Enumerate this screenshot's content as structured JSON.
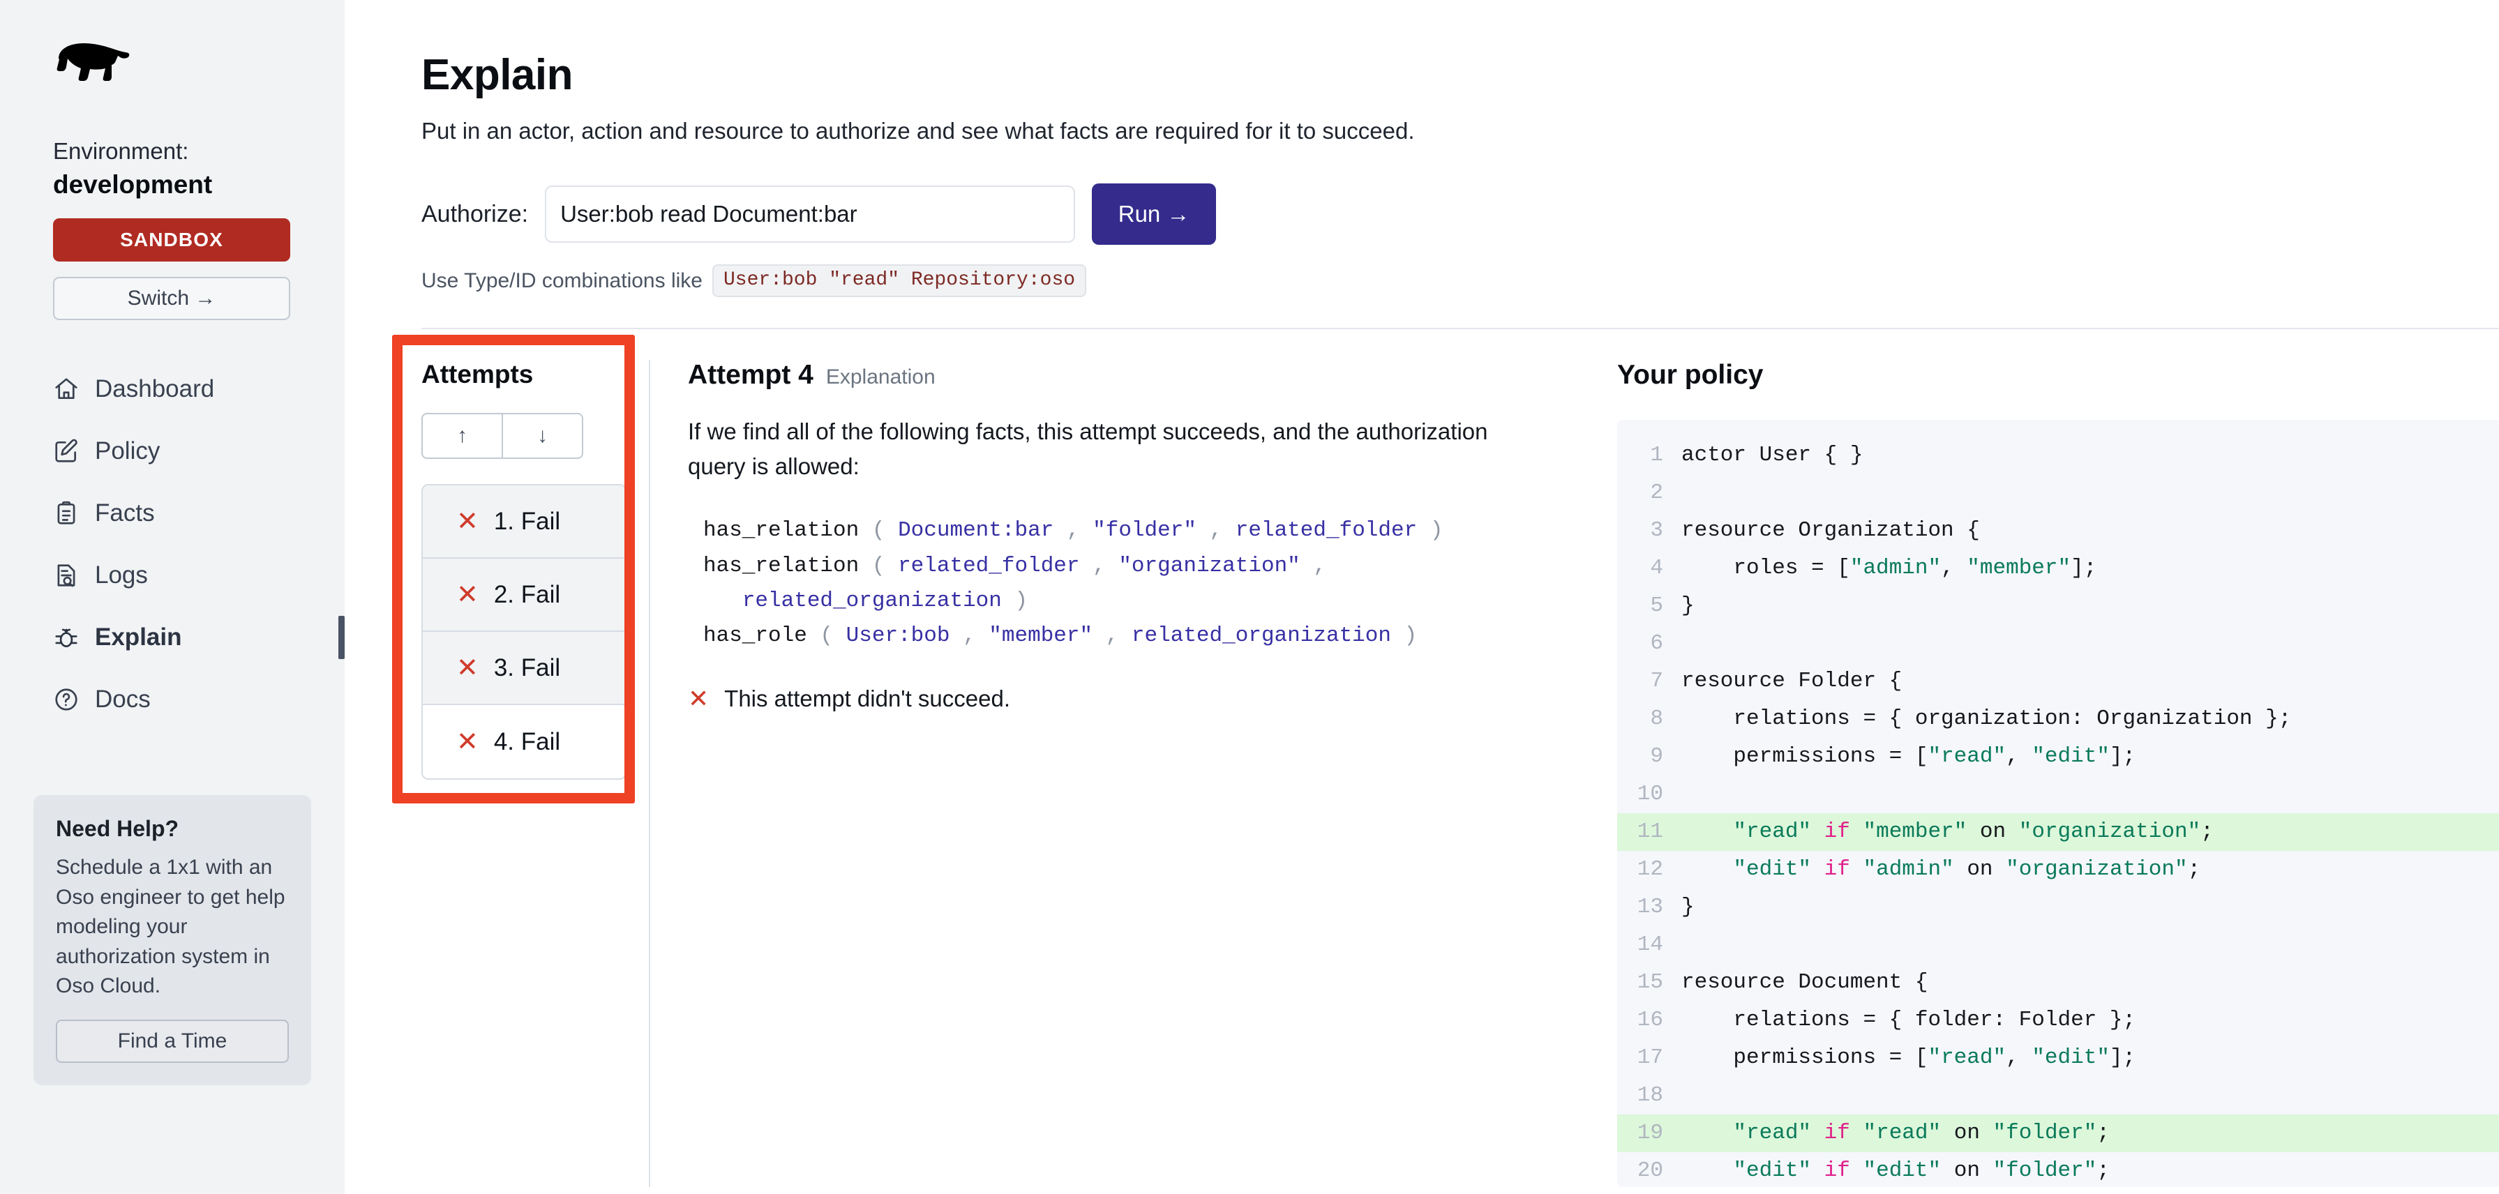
{
  "sidebar": {
    "logo_icon": "bear-logo-icon",
    "environment_label": "Environment:",
    "environment_value": "development",
    "sandbox_badge": "SANDBOX",
    "switch_label": "Switch →",
    "nav": [
      {
        "label": "Dashboard",
        "icon": "home-icon",
        "active": false
      },
      {
        "label": "Policy",
        "icon": "edit-square-icon",
        "active": false
      },
      {
        "label": "Facts",
        "icon": "clipboard-list-icon",
        "active": false
      },
      {
        "label": "Logs",
        "icon": "document-search-icon",
        "active": false
      },
      {
        "label": "Explain",
        "icon": "bug-icon",
        "active": true
      },
      {
        "label": "Docs",
        "icon": "question-circle-icon",
        "active": false
      }
    ],
    "help": {
      "title": "Need Help?",
      "body": "Schedule a 1x1 with an Oso engineer to get help modeling your authorization system in Oso Cloud.",
      "button": "Find a Time"
    }
  },
  "page": {
    "title": "Explain",
    "subtitle": "Put in an actor, action and resource to authorize and see what facts are required for it to succeed."
  },
  "authorize": {
    "label": "Authorize:",
    "value": "User:bob read Document:bar",
    "placeholder": "User:bob read Document:bar",
    "run_label": "Run →",
    "hint_prefix": "Use Type/ID combinations like",
    "hint_code": "User:bob \"read\" Repository:oso"
  },
  "attempts": {
    "title": "Attempts",
    "sort_up": "↑",
    "sort_down": "↓",
    "items": [
      {
        "label": "1. Fail",
        "status_icon": "x-icon",
        "selected": false
      },
      {
        "label": "2. Fail",
        "status_icon": "x-icon",
        "selected": false
      },
      {
        "label": "3. Fail",
        "status_icon": "x-icon",
        "selected": false
      },
      {
        "label": "4. Fail",
        "status_icon": "x-icon",
        "selected": true
      }
    ]
  },
  "explanation": {
    "heading": "Attempt 4",
    "subheading": "Explanation",
    "paragraph": "If we find all of the following facts, this attempt succeeds, and the authorization query is allowed:",
    "facts": [
      [
        {
          "t": "has_relation",
          "k": "pred"
        },
        {
          "t": " ( ",
          "k": "punc"
        },
        {
          "t": "Document:bar",
          "k": "arg"
        },
        {
          "t": " , ",
          "k": "punc"
        },
        {
          "t": "\"folder\"",
          "k": "arg"
        },
        {
          "t": " , ",
          "k": "punc"
        },
        {
          "t": "related_folder",
          "k": "arg"
        },
        {
          "t": " )",
          "k": "punc"
        }
      ],
      [
        {
          "t": "has_relation",
          "k": "pred"
        },
        {
          "t": " ( ",
          "k": "punc"
        },
        {
          "t": "related_folder",
          "k": "arg"
        },
        {
          "t": " , ",
          "k": "punc"
        },
        {
          "t": "\"organization\"",
          "k": "arg"
        },
        {
          "t": " ,\n   ",
          "k": "punc"
        },
        {
          "t": "related_organization",
          "k": "arg"
        },
        {
          "t": " )",
          "k": "punc"
        }
      ],
      [
        {
          "t": "has_role",
          "k": "pred"
        },
        {
          "t": " ( ",
          "k": "punc"
        },
        {
          "t": "User:bob",
          "k": "arg"
        },
        {
          "t": " , ",
          "k": "punc"
        },
        {
          "t": "\"member\"",
          "k": "arg"
        },
        {
          "t": " , ",
          "k": "punc"
        },
        {
          "t": "related_organization",
          "k": "arg"
        },
        {
          "t": " )",
          "k": "punc"
        }
      ]
    ],
    "result_icon": "x-icon",
    "result_text": "This attempt didn't succeed."
  },
  "policy": {
    "title": "Your policy",
    "lines": [
      {
        "n": "1",
        "hl": false,
        "parts": [
          {
            "t": "actor User { }",
            "k": "txt"
          }
        ]
      },
      {
        "n": "2",
        "hl": false,
        "parts": []
      },
      {
        "n": "3",
        "hl": false,
        "parts": [
          {
            "t": "resource Organization {",
            "k": "txt"
          }
        ]
      },
      {
        "n": "4",
        "hl": false,
        "parts": [
          {
            "t": "    roles = [",
            "k": "txt"
          },
          {
            "t": "\"admin\"",
            "k": "str"
          },
          {
            "t": ", ",
            "k": "txt"
          },
          {
            "t": "\"member\"",
            "k": "str"
          },
          {
            "t": "];",
            "k": "txt"
          }
        ]
      },
      {
        "n": "5",
        "hl": false,
        "parts": [
          {
            "t": "}",
            "k": "txt"
          }
        ]
      },
      {
        "n": "6",
        "hl": false,
        "parts": []
      },
      {
        "n": "7",
        "hl": false,
        "parts": [
          {
            "t": "resource Folder {",
            "k": "txt"
          }
        ]
      },
      {
        "n": "8",
        "hl": false,
        "parts": [
          {
            "t": "    relations = { organization: Organization };",
            "k": "txt"
          }
        ]
      },
      {
        "n": "9",
        "hl": false,
        "parts": [
          {
            "t": "    permissions = [",
            "k": "txt"
          },
          {
            "t": "\"read\"",
            "k": "str"
          },
          {
            "t": ", ",
            "k": "txt"
          },
          {
            "t": "\"edit\"",
            "k": "str"
          },
          {
            "t": "];",
            "k": "txt"
          }
        ]
      },
      {
        "n": "10",
        "hl": false,
        "parts": []
      },
      {
        "n": "11",
        "hl": true,
        "parts": [
          {
            "t": "    ",
            "k": "txt"
          },
          {
            "t": "\"read\"",
            "k": "str"
          },
          {
            "t": " ",
            "k": "txt"
          },
          {
            "t": "if",
            "k": "kw"
          },
          {
            "t": " ",
            "k": "txt"
          },
          {
            "t": "\"member\"",
            "k": "str"
          },
          {
            "t": " on ",
            "k": "txt"
          },
          {
            "t": "\"organization\"",
            "k": "str"
          },
          {
            "t": ";",
            "k": "txt"
          }
        ]
      },
      {
        "n": "12",
        "hl": false,
        "parts": [
          {
            "t": "    ",
            "k": "txt"
          },
          {
            "t": "\"edit\"",
            "k": "str"
          },
          {
            "t": " ",
            "k": "txt"
          },
          {
            "t": "if",
            "k": "kw"
          },
          {
            "t": " ",
            "k": "txt"
          },
          {
            "t": "\"admin\"",
            "k": "str"
          },
          {
            "t": " on ",
            "k": "txt"
          },
          {
            "t": "\"organization\"",
            "k": "str"
          },
          {
            "t": ";",
            "k": "txt"
          }
        ]
      },
      {
        "n": "13",
        "hl": false,
        "parts": [
          {
            "t": "}",
            "k": "txt"
          }
        ]
      },
      {
        "n": "14",
        "hl": false,
        "parts": []
      },
      {
        "n": "15",
        "hl": false,
        "parts": [
          {
            "t": "resource Document {",
            "k": "txt"
          }
        ]
      },
      {
        "n": "16",
        "hl": false,
        "parts": [
          {
            "t": "    relations = { folder: Folder };",
            "k": "txt"
          }
        ]
      },
      {
        "n": "17",
        "hl": false,
        "parts": [
          {
            "t": "    permissions = [",
            "k": "txt"
          },
          {
            "t": "\"read\"",
            "k": "str"
          },
          {
            "t": ", ",
            "k": "txt"
          },
          {
            "t": "\"edit\"",
            "k": "str"
          },
          {
            "t": "];",
            "k": "txt"
          }
        ]
      },
      {
        "n": "18",
        "hl": false,
        "parts": []
      },
      {
        "n": "19",
        "hl": true,
        "parts": [
          {
            "t": "    ",
            "k": "txt"
          },
          {
            "t": "\"read\"",
            "k": "str"
          },
          {
            "t": " ",
            "k": "txt"
          },
          {
            "t": "if",
            "k": "kw"
          },
          {
            "t": " ",
            "k": "txt"
          },
          {
            "t": "\"read\"",
            "k": "str"
          },
          {
            "t": " on ",
            "k": "txt"
          },
          {
            "t": "\"folder\"",
            "k": "str"
          },
          {
            "t": ";",
            "k": "txt"
          }
        ]
      },
      {
        "n": "20",
        "hl": false,
        "parts": [
          {
            "t": "    ",
            "k": "txt"
          },
          {
            "t": "\"edit\"",
            "k": "str"
          },
          {
            "t": " ",
            "k": "txt"
          },
          {
            "t": "if",
            "k": "kw"
          },
          {
            "t": " ",
            "k": "txt"
          },
          {
            "t": "\"edit\"",
            "k": "str"
          },
          {
            "t": " on ",
            "k": "txt"
          },
          {
            "t": "\"folder\"",
            "k": "str"
          },
          {
            "t": ";",
            "k": "txt"
          }
        ]
      }
    ]
  },
  "colors": {
    "sandbox_red": "#b02b22",
    "run_indigo": "#342b8c",
    "annotation_red": "#ef4123",
    "fail_x_red": "#cf3b2b",
    "highlight_green": "#ddf7da",
    "code_string_green": "#0a7a5a",
    "code_keyword_pink": "#e0218a",
    "fact_arg_blue": "#3730a3"
  }
}
